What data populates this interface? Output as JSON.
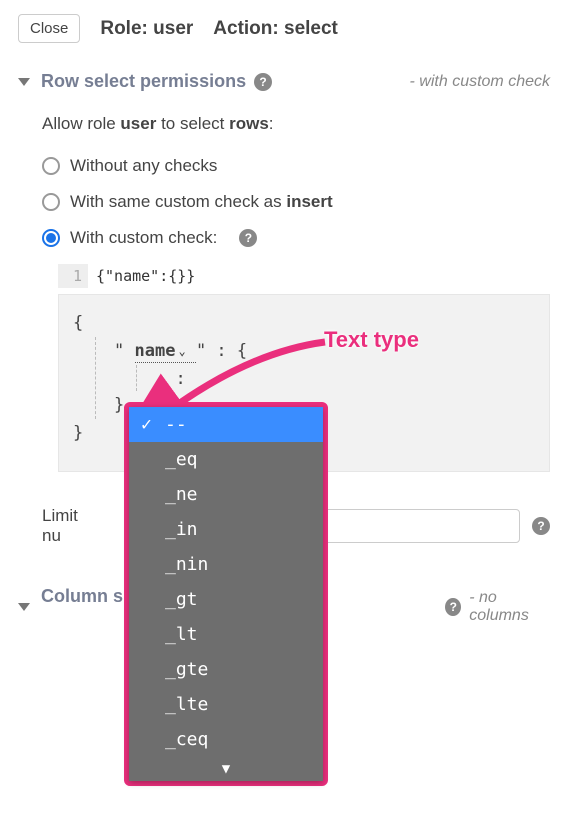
{
  "top": {
    "close": "Close",
    "role_label": "Role:",
    "role_value": "user",
    "action_label": "Action:",
    "action_value": "select"
  },
  "row_section": {
    "title": "Row select permissions",
    "suffix": "- with custom check",
    "allow_prefix": "Allow role ",
    "allow_role": "user",
    "allow_mid": " to select ",
    "allow_target": "rows",
    "allow_colon": ":",
    "options": {
      "without": "Without any checks",
      "same_prefix": "With same custom check as ",
      "same_bold": "insert",
      "custom": "With custom check:"
    },
    "code": {
      "line_no": "1",
      "content": "{\"name\":{}}"
    },
    "builder": {
      "open": "{",
      "field_quote": "\"",
      "field_name": "name",
      "field_after": "\" :    {",
      "inner_colon": ":",
      "close_inner": "}",
      "close": "}"
    }
  },
  "dropdown": {
    "items": [
      "--",
      "_eq",
      "_ne",
      "_in",
      "_nin",
      "_gt",
      "_lt",
      "_gte",
      "_lte",
      "_ceq"
    ],
    "selected_index": 0
  },
  "annotation": {
    "text": "Text type"
  },
  "limit": {
    "label_visible": "Limit nu"
  },
  "column_section": {
    "title_prefix": "Column s",
    "title_suffix_vis": "s",
    "suffix": "- no columns"
  }
}
